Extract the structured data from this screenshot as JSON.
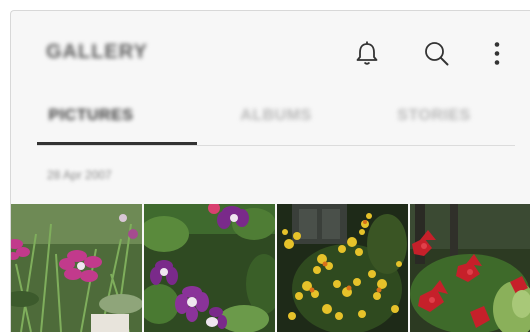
{
  "header": {
    "title": "GALLERY",
    "icons": [
      "bell-icon",
      "search-icon",
      "more-options-icon"
    ]
  },
  "tabs": [
    {
      "label": "PICTURES",
      "active": true
    },
    {
      "label": "ALBUMS",
      "active": false
    },
    {
      "label": "STORIES",
      "active": false
    }
  ],
  "section": {
    "date": "28 Apr 2007"
  },
  "thumbnails": [
    {
      "subject": "pink-flower"
    },
    {
      "subject": "purple-columbine-flowers"
    },
    {
      "subject": "yellow-flowering-shrub"
    },
    {
      "subject": "red-flowers"
    }
  ],
  "colors": {
    "background": "#f7f7f7",
    "icon": "#333333",
    "active_tab": "#3a3a3a",
    "inactive_tab": "#b8b8b8"
  }
}
